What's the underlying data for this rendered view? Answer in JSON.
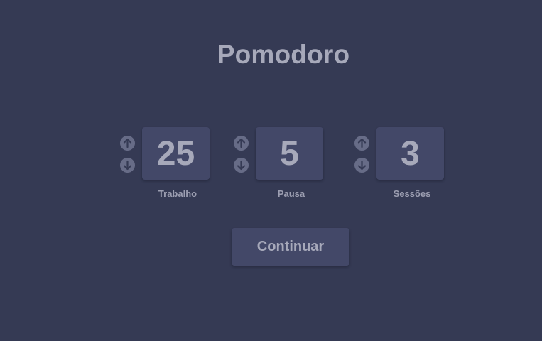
{
  "app": {
    "title": "Pomodoro"
  },
  "settings": [
    {
      "label": "Trabalho",
      "value": "25",
      "up_icon": "arrow-up-icon",
      "down_icon": "arrow-down-icon"
    },
    {
      "label": "Pausa",
      "value": "5",
      "up_icon": "arrow-up-icon",
      "down_icon": "arrow-down-icon"
    },
    {
      "label": "Sessões",
      "value": "3",
      "up_icon": "arrow-up-icon",
      "down_icon": "arrow-down-icon"
    }
  ],
  "actions": {
    "continue_label": "Continuar"
  },
  "colors": {
    "background": "#353a54",
    "panel": "#434868",
    "text": "#a7a9ba",
    "icon_circle": "#676c87"
  }
}
